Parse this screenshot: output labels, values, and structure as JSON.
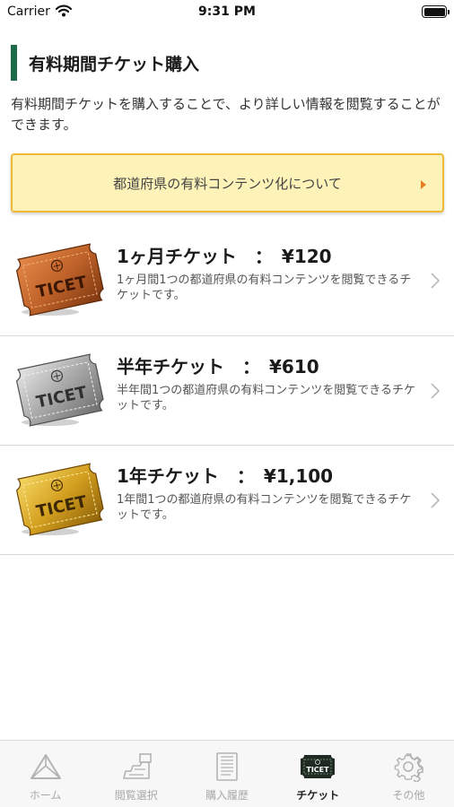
{
  "status_bar": {
    "carrier": "Carrier",
    "time": "9:31 PM",
    "battery_level": 1.0
  },
  "header": {
    "title": "有料期間チケット購入",
    "accent_color": "#1f6b47"
  },
  "intro": "有料期間チケットを購入することで、より詳しい情報を閲覧することができます。",
  "info_banner": {
    "label": "都道府県の有料コンテンツ化について",
    "background": "#fdf3b8",
    "border_color": "#f0b935",
    "arrow_color": "#e67e22"
  },
  "tickets": [
    {
      "name": "1ヶ月チケット　：　¥120",
      "description": "1ヶ月間1つの都道府県の有料コンテンツを閲覧できるチケットです。",
      "icon": "bronze-ticket-icon",
      "icon_text": "TICET",
      "color": "#c0632a"
    },
    {
      "name": "半年チケット　：　¥610",
      "description": "半年間1つの都道府県の有料コンテンツを閲覧できるチケットです。",
      "icon": "silver-ticket-icon",
      "icon_text": "TICET",
      "color": "#a8a8a8"
    },
    {
      "name": "1年チケット　：　¥1,100",
      "description": "1年間1つの都道府県の有料コンテンツを閲覧できるチケットです。",
      "icon": "gold-ticket-icon",
      "icon_text": "TICET",
      "color": "#d4a020"
    }
  ],
  "tab_bar": {
    "active_index": 3,
    "items": [
      {
        "label": "ホーム",
        "icon": "home-icon"
      },
      {
        "label": "閲覧選択",
        "icon": "browse-select-icon"
      },
      {
        "label": "購入履歴",
        "icon": "purchase-history-icon"
      },
      {
        "label": "チケット",
        "icon": "ticket-icon",
        "icon_text": "TICET"
      },
      {
        "label": "その他",
        "icon": "gear-icon"
      }
    ]
  }
}
